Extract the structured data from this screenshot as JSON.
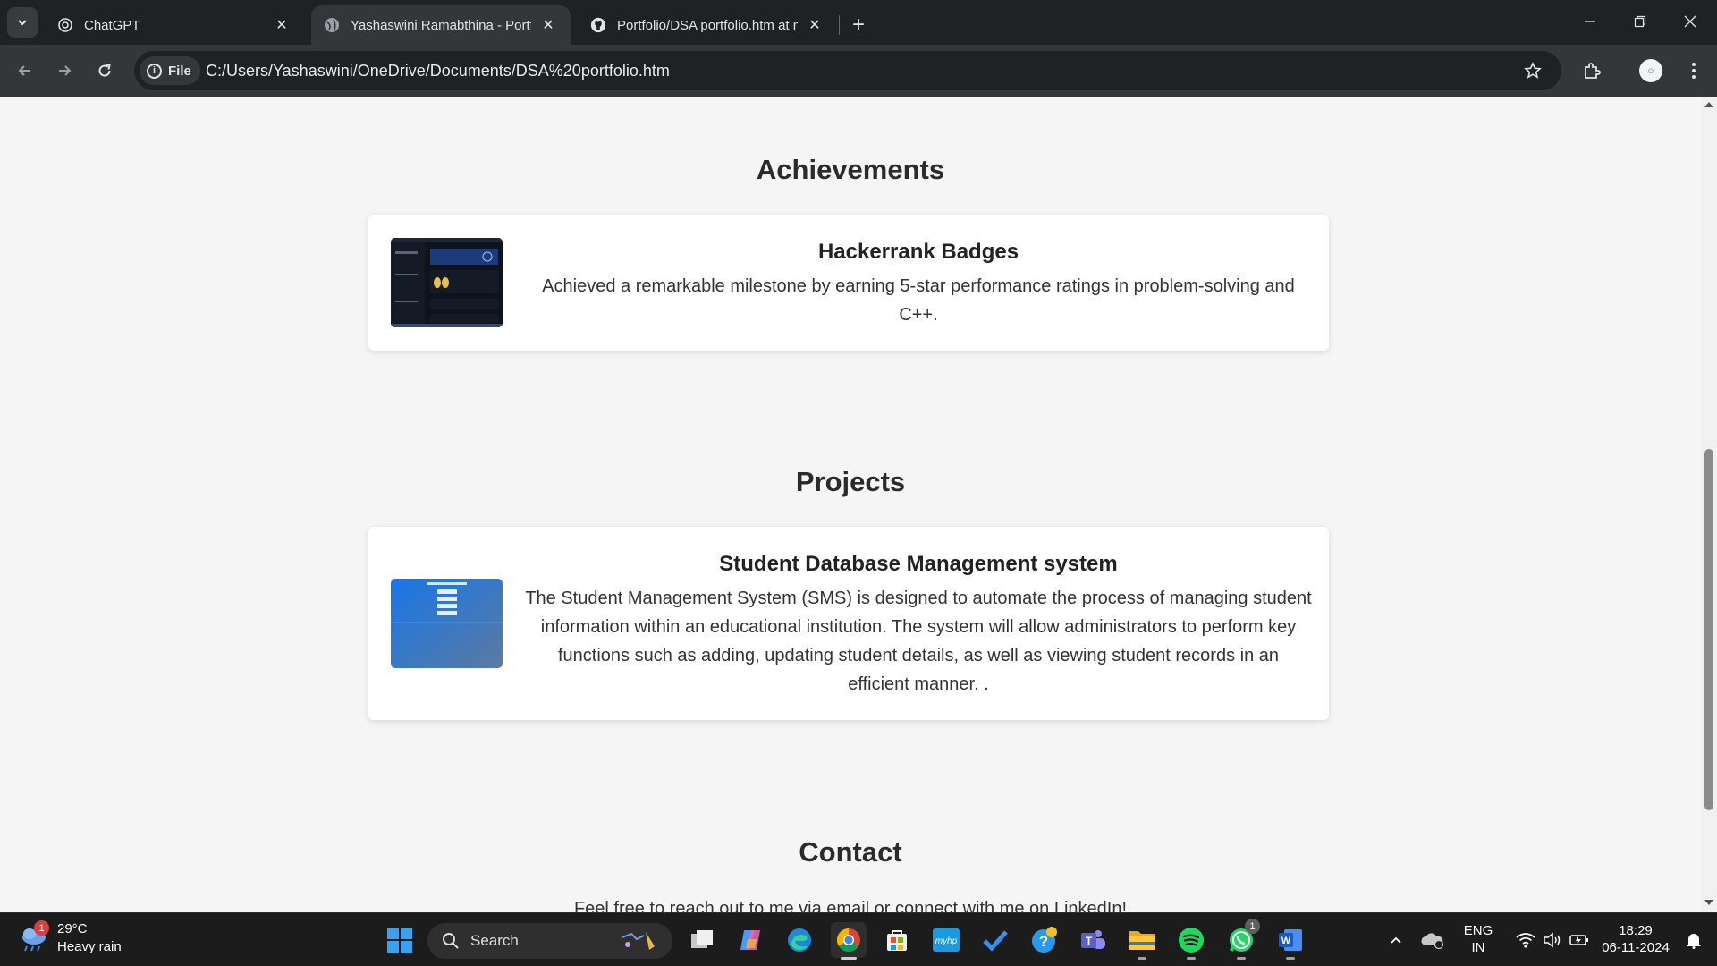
{
  "browser": {
    "tabs": [
      {
        "title": "ChatGPT",
        "icon": "chatgpt-icon",
        "active": false
      },
      {
        "title": "Yashaswini Ramabthina - Portfolio",
        "icon": "globe-icon",
        "active": true
      },
      {
        "title": "Portfolio/DSA portfolio.htm at main",
        "icon": "github-icon",
        "active": false
      }
    ],
    "address": {
      "chip_label": "File",
      "url": "C:/Users/Yashaswini/OneDrive/Documents/DSA%20portfolio.htm"
    }
  },
  "page": {
    "achievements": {
      "heading": "Achievements",
      "card": {
        "title": "Hackerrank Badges",
        "description": "Achieved a remarkable milestone by earning 5-star performance ratings in problem-solving and C++."
      }
    },
    "projects": {
      "heading": "Projects",
      "card": {
        "title": "Student Database Management system",
        "description": "The Student Management System (SMS) is designed to automate the process of managing student information within an educational institution. The system will allow administrators to perform key functions such as adding, updating student details, as well as viewing student records in an efficient manner. ."
      }
    },
    "contact": {
      "heading": "Contact",
      "text": "Feel free to reach out to me via email or connect with me on LinkedIn!"
    }
  },
  "taskbar": {
    "weather": {
      "temp": "29°C",
      "condition": "Heavy rain",
      "badge": "1"
    },
    "search_label": "Search",
    "whatsapp_badge": "1",
    "language": {
      "line1": "ENG",
      "line2": "IN"
    },
    "clock": {
      "time": "18:29",
      "date": "06-11-2024"
    }
  },
  "colors": {
    "page_bg": "#f5f5f5",
    "card_bg": "#ffffff",
    "chrome_dark": "#202124",
    "chrome_toolbar": "#35363a",
    "taskbar_bg": "#1c1c1c"
  }
}
